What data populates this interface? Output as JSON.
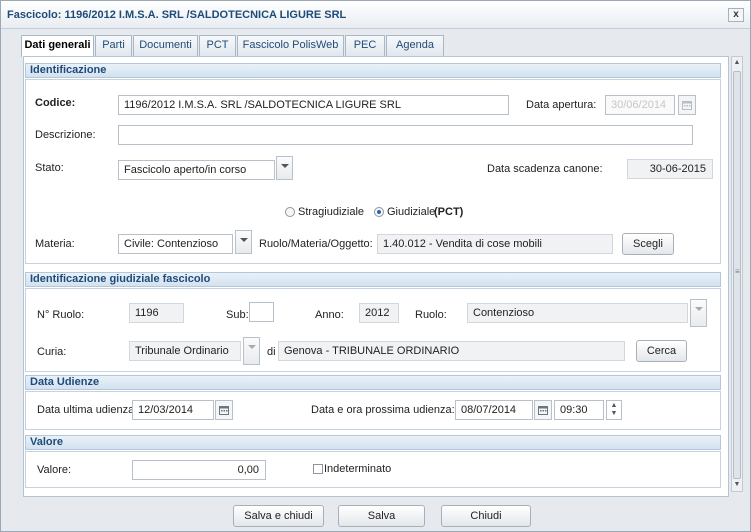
{
  "window": {
    "title": "Fascicolo: 1196/2012 I.M.S.A. SRL /SALDOTECNICA LIGURE SRL",
    "close_label": "x"
  },
  "tabs": [
    {
      "label": "Dati generali",
      "active": true
    },
    {
      "label": "Parti"
    },
    {
      "label": "Documenti"
    },
    {
      "label": "PCT"
    },
    {
      "label": "Fascicolo PolisWeb"
    },
    {
      "label": "PEC"
    },
    {
      "label": "Agenda"
    }
  ],
  "identificazione": {
    "heading": "Identificazione",
    "codice_label": "Codice:",
    "codice_value": "1196/2012 I.M.S.A. SRL /SALDOTECNICA LIGURE SRL",
    "data_apertura_label": "Data apertura:",
    "data_apertura_value": "30/06/2014",
    "descrizione_label": "Descrizione:",
    "descrizione_value": "",
    "stato_label": "Stato:",
    "stato_value": "Fascicolo aperto/in corso",
    "scadenza_label": "Data scadenza canone:",
    "scadenza_value": "30-06-2015",
    "radio_stragiudiziale": "Stragiudiziale",
    "radio_giudiziale": "Giudiziale",
    "radio_giudiziale_suffix": "(PCT)",
    "materia_label": "Materia:",
    "materia_value": "Civile: Contenzioso",
    "rmo_label": "Ruolo/Materia/Oggetto:",
    "rmo_value": "1.40.012 - Vendita di cose mobili",
    "scegli_label": "Scegli"
  },
  "giudiziale": {
    "heading": "Identificazione giudiziale fascicolo",
    "nruolo_label": "N° Ruolo:",
    "nruolo_value": "1196",
    "sub_label": "Sub:",
    "sub_value": "",
    "anno_label": "Anno:",
    "anno_value": "2012",
    "ruolo_label": "Ruolo:",
    "ruolo_value": "Contenzioso",
    "curia_label": "Curia:",
    "curia_value": "Tribunale Ordinario",
    "di_label": "di",
    "di_value": "Genova - TRIBUNALE ORDINARIO",
    "cerca_label": "Cerca"
  },
  "udienze": {
    "heading": "Data Udienze",
    "ultima_label": "Data ultima udienza:",
    "ultima_value": "12/03/2014",
    "prossima_label": "Data e ora prossima udienza:",
    "prossima_date": "08/07/2014",
    "prossima_time": "09:30"
  },
  "valore": {
    "heading": "Valore",
    "valore_label": "Valore:",
    "valore_value": "0,00",
    "indeterminato_label": "Indeterminato"
  },
  "footer": {
    "salva_chiudi": "Salva e chiudi",
    "salva": "Salva",
    "chiudi": "Chiudi"
  }
}
